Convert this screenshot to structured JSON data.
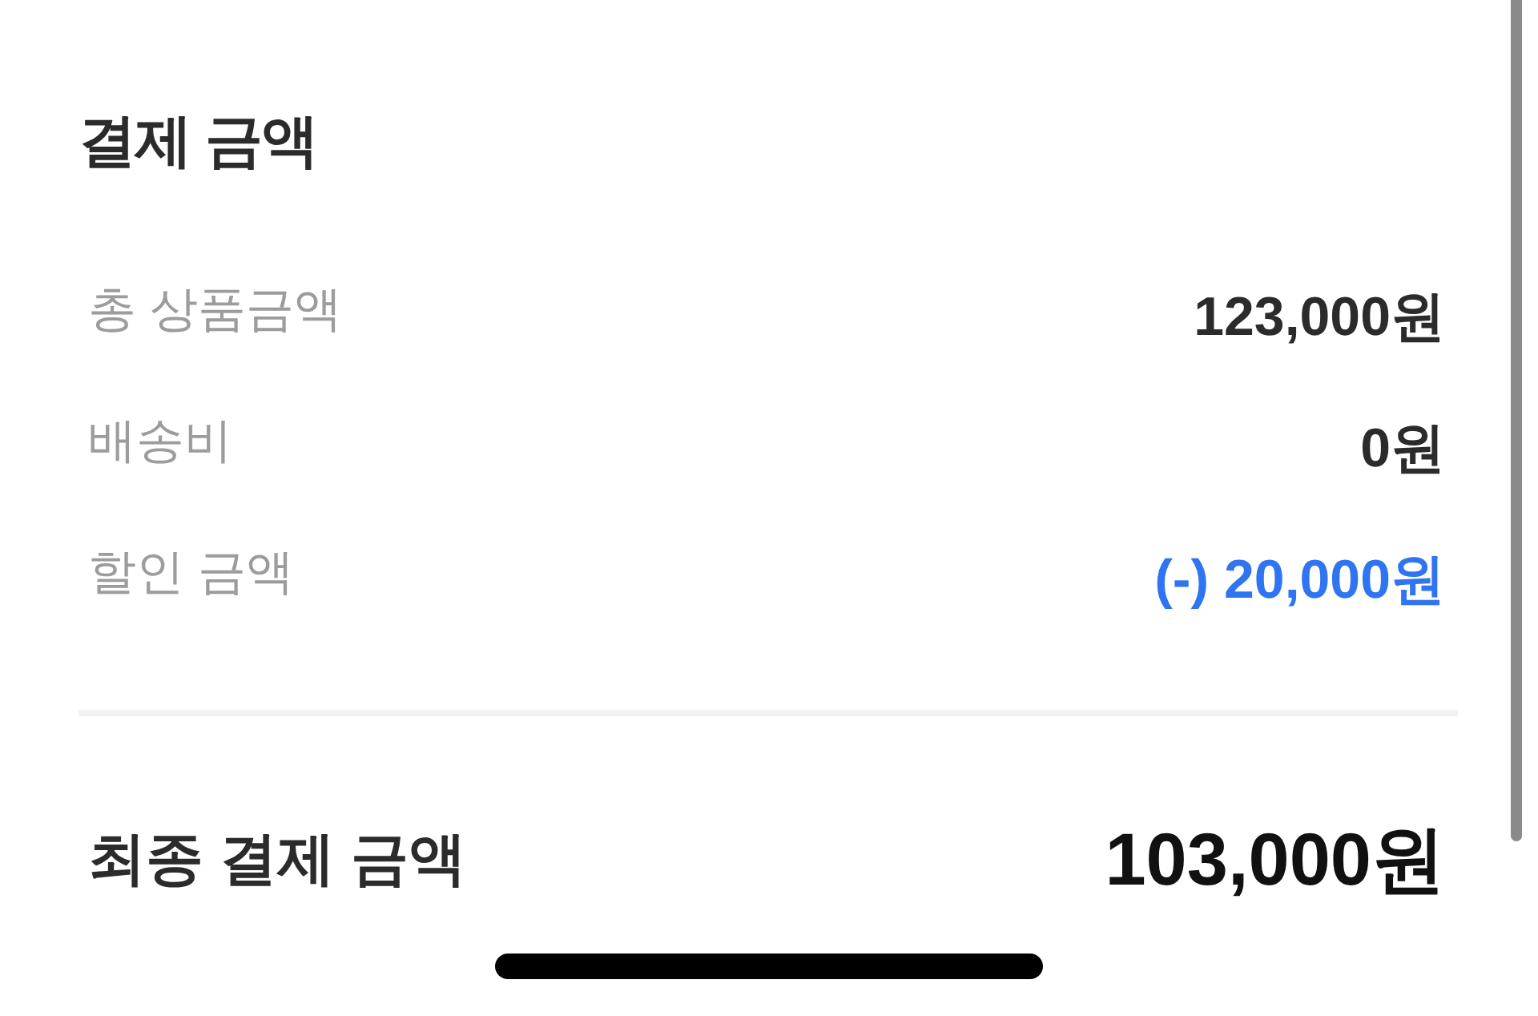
{
  "section_title": "결제 금액",
  "rows": [
    {
      "kind": "charge",
      "label": "총 상품금액",
      "value": "123,000원"
    },
    {
      "kind": "charge",
      "label": "배송비",
      "value": "0원"
    },
    {
      "kind": "discount",
      "label": "할인 금액",
      "value": "(-) 20,000원"
    }
  ],
  "total": {
    "label": "최종 결제 금액",
    "value": "103,000원"
  }
}
